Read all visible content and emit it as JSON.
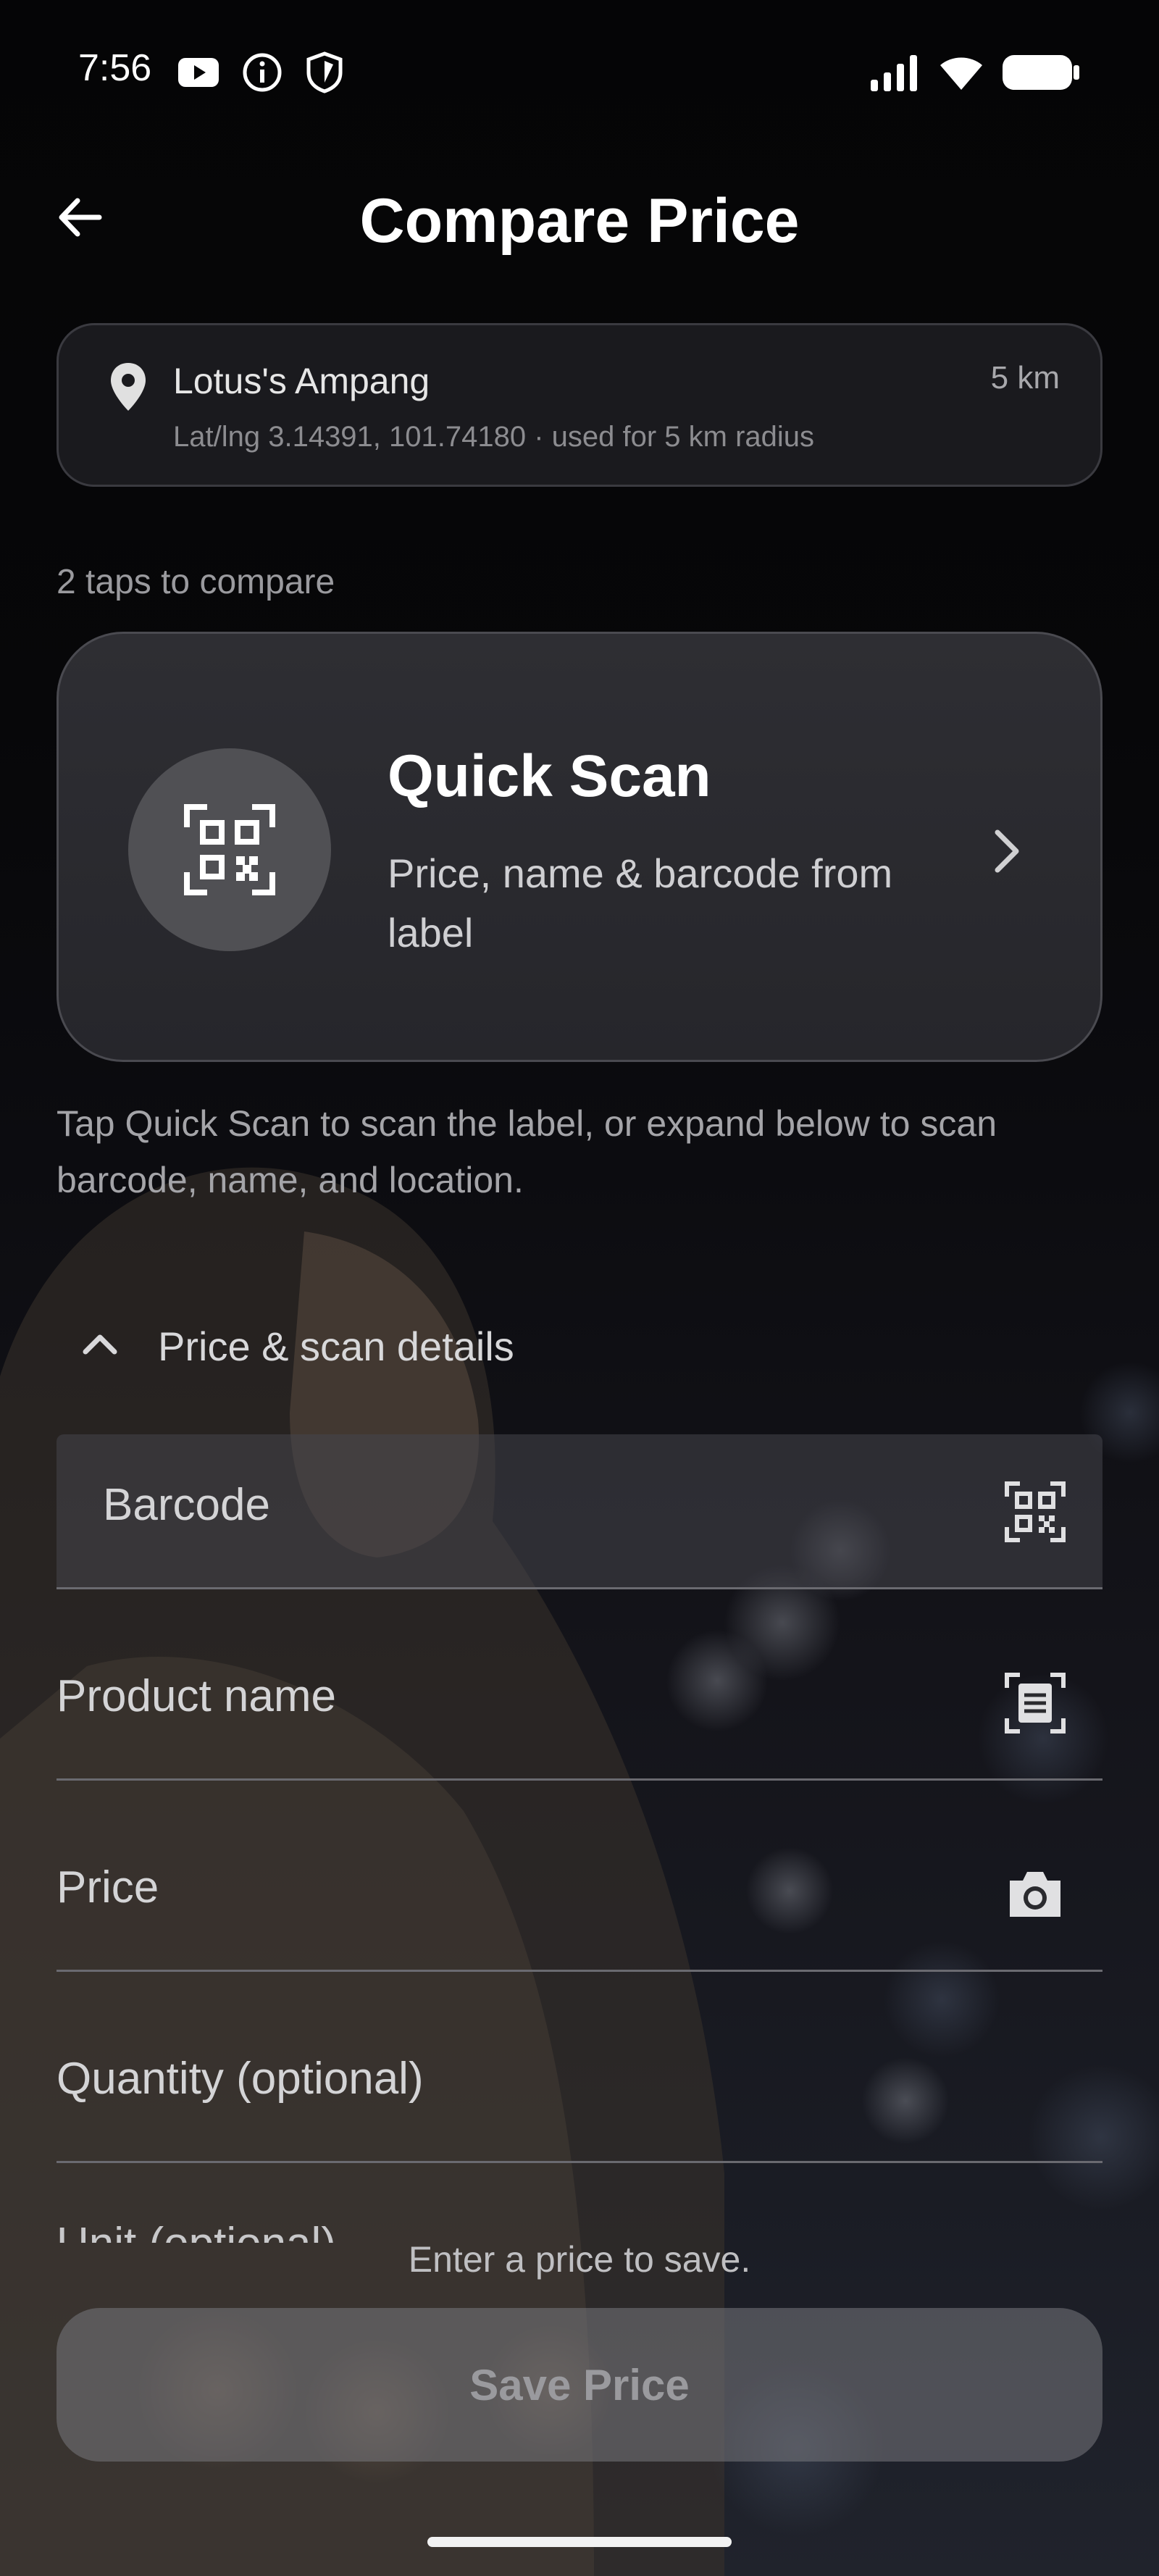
{
  "status_bar": {
    "time": "7:56",
    "icons": [
      "youtube-icon",
      "info-icon",
      "shield-icon",
      "signal-icon",
      "wifi-icon",
      "battery-icon"
    ]
  },
  "header": {
    "title": "Compare Price",
    "back_icon": "arrow-left-icon"
  },
  "location": {
    "name": "Lotus's Ampang",
    "distance": "5 km",
    "coords": "Lat/lng 3.14391, 101.74180 · used for 5 km radius",
    "icon": "location-pin-icon"
  },
  "taps_hint": "2 taps to compare",
  "quick_scan": {
    "title": "Quick Scan",
    "subtitle": "Price, name & barcode from label",
    "icon": "qr-scan-icon"
  },
  "scan_hint": "Tap Quick Scan to scan the label, or expand below to scan barcode, name, and location.",
  "expander": {
    "label": "Price & scan details",
    "icon": "chevron-up-icon"
  },
  "fields": {
    "barcode": {
      "label": "Barcode",
      "icon": "qr-scan-icon"
    },
    "product_name": {
      "label": "Product name",
      "icon": "text-scan-icon"
    },
    "price": {
      "label": "Price",
      "icon": "camera-icon"
    },
    "quantity": {
      "label": "Quantity (optional)"
    },
    "unit": {
      "label": "Unit (optional)"
    }
  },
  "footer": {
    "hint": "Enter a price to save.",
    "save_label": "Save Price"
  },
  "colors": {
    "background": "#050506",
    "card": "#1a1a1e",
    "quick_scan_card": "#2e2e33",
    "button_disabled": "#7a7a80"
  }
}
